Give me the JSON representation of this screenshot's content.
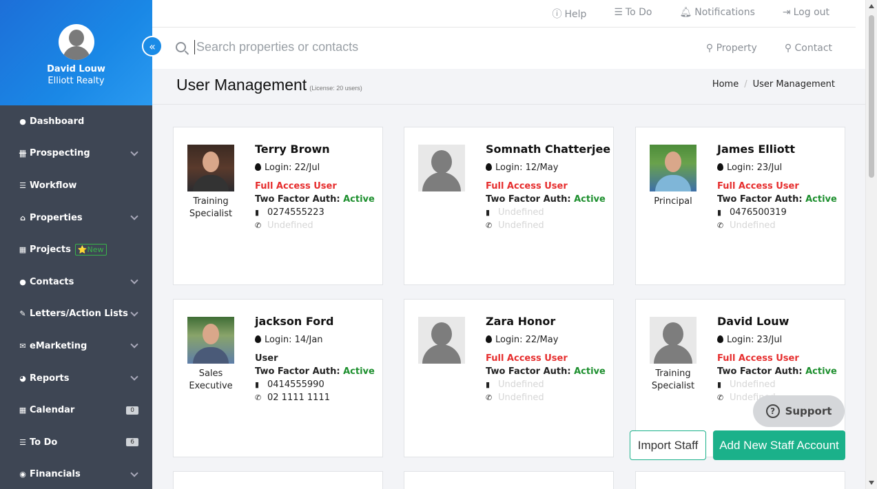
{
  "profile": {
    "name": "David Louw",
    "company": "Elliott Realty",
    "collapse_icon": "«"
  },
  "nav": [
    {
      "label": "Dashboard",
      "icon": "●"
    },
    {
      "label": "Prospecting",
      "icon": "卌"
    },
    {
      "label": "Workflow",
      "icon": "☰"
    },
    {
      "label": "Properties",
      "icon": "⌂"
    },
    {
      "label": "Projects",
      "icon": "▦",
      "tag": "⭐New"
    },
    {
      "label": "Contacts",
      "icon": "●"
    },
    {
      "label": "Letters/Action Lists",
      "icon": "✎"
    },
    {
      "label": "eMarketing",
      "icon": "✉"
    },
    {
      "label": "Reports",
      "icon": "◕"
    },
    {
      "label": "Calendar",
      "icon": "▦",
      "badge": "0"
    },
    {
      "label": "To Do",
      "icon": "☰",
      "badge": "6"
    },
    {
      "label": "Financials",
      "icon": "◉"
    }
  ],
  "toplinks": {
    "help": "Help",
    "todo": "To Do",
    "notifications": "Notifications",
    "logout": "Log out"
  },
  "search": {
    "placeholder": "Search properties or contacts",
    "scope_property": "Property",
    "scope_contact": "Contact"
  },
  "page": {
    "title": "User Management",
    "license": "(License: 20 users)"
  },
  "breadcrumb": {
    "home": "Home",
    "current": "User Management"
  },
  "users": [
    {
      "name": "Terry Brown",
      "login": "Login: 22/Jul",
      "access": "Full Access User",
      "tfa_label": "Two Factor Auth:",
      "tfa_status": "Active",
      "mobile": "0274555223",
      "phone": "Undefined",
      "role": "Training Specialist"
    },
    {
      "name": "Somnath Chatterjee",
      "login": "Login: 12/May",
      "access": "Full Access User",
      "tfa_label": "Two Factor Auth:",
      "tfa_status": "Active",
      "mobile": "Undefined",
      "phone": "Undefined",
      "role": ""
    },
    {
      "name": "James Elliott",
      "login": "Login: 23/Jul",
      "access": "Full Access User",
      "tfa_label": "Two Factor Auth:",
      "tfa_status": "Active",
      "mobile": "0476500319",
      "phone": "Undefined",
      "role": "Principal"
    },
    {
      "name": "jackson Ford",
      "login": "Login: 14/Jan",
      "access": "User",
      "tfa_label": "Two Factor Auth:",
      "tfa_status": "Active",
      "mobile": "0414555990",
      "phone": "02 1111 1111",
      "role": "Sales Executive"
    },
    {
      "name": "Zara Honor",
      "login": "Login: 22/May",
      "access": "Full Access User",
      "tfa_label": "Two Factor Auth:",
      "tfa_status": "Active",
      "mobile": "Undefined",
      "phone": "Undefined",
      "role": ""
    },
    {
      "name": "David Louw",
      "login": "Login: 23/Jul",
      "access": "Full Access User",
      "tfa_label": "Two Factor Auth:",
      "tfa_status": "Active",
      "mobile": "Undefined",
      "phone": "Undefined",
      "role": "Training Specialist"
    }
  ],
  "actions": {
    "support": "Support",
    "import": "Import Staff",
    "add": "Add New Staff Account"
  },
  "colors": {
    "accent": "#1bb18a",
    "sidebar": "#3e4654",
    "danger": "#e62e2e",
    "success": "#1d8f2e"
  }
}
